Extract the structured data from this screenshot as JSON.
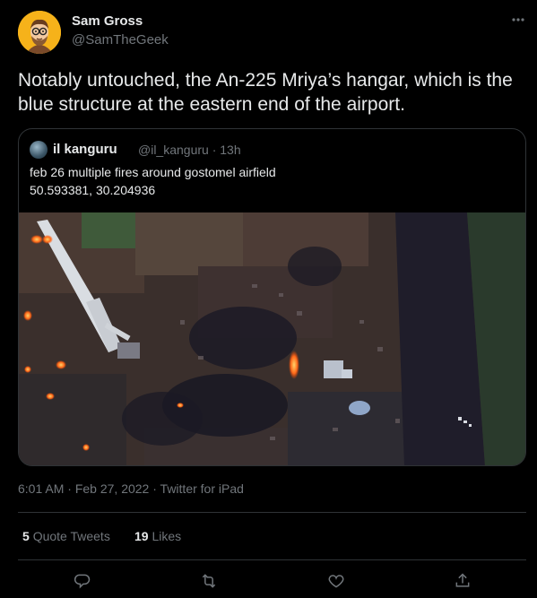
{
  "author": {
    "name": "Sam Gross",
    "handle": "@SamTheGeek"
  },
  "tweet": {
    "text": "Notably untouched, the An-225 Mriya’s hangar, which is the blue structure at the eastern end of the airport."
  },
  "quoted": {
    "name": "il kanguru",
    "handle_time": "@il_kanguru · 13h",
    "line1": "feb 26 multiple fires around gostomel airfield",
    "line2": "50.593381, 30.204936"
  },
  "meta": {
    "time": "6:01 AM",
    "date": "Feb 27, 2022",
    "source": "Twitter for iPad",
    "sep": "·"
  },
  "stats": {
    "quotes_count": "5",
    "quotes_label": "Quote Tweets",
    "likes_count": "19",
    "likes_label": "Likes"
  },
  "icons": {
    "more": "more-icon",
    "reply": "reply-icon",
    "retweet": "retweet-icon",
    "like": "like-icon",
    "share": "share-icon"
  },
  "colors": {
    "background": "#000000",
    "text": "#e7e9ea",
    "secondary": "#71767b",
    "border": "#2f3336"
  }
}
